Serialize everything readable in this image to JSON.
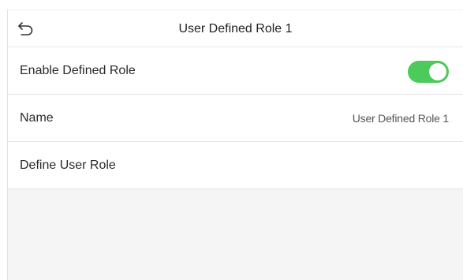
{
  "header": {
    "title": "User Defined Role 1",
    "back_icon": "back-arrow-icon"
  },
  "settings": [
    {
      "label": "Enable Defined Role",
      "control": "toggle",
      "toggle_on": true,
      "toggle_color": "#4ccb5a"
    },
    {
      "label": "Name",
      "value": "User Defined Role 1"
    },
    {
      "label": "Define User Role"
    }
  ]
}
